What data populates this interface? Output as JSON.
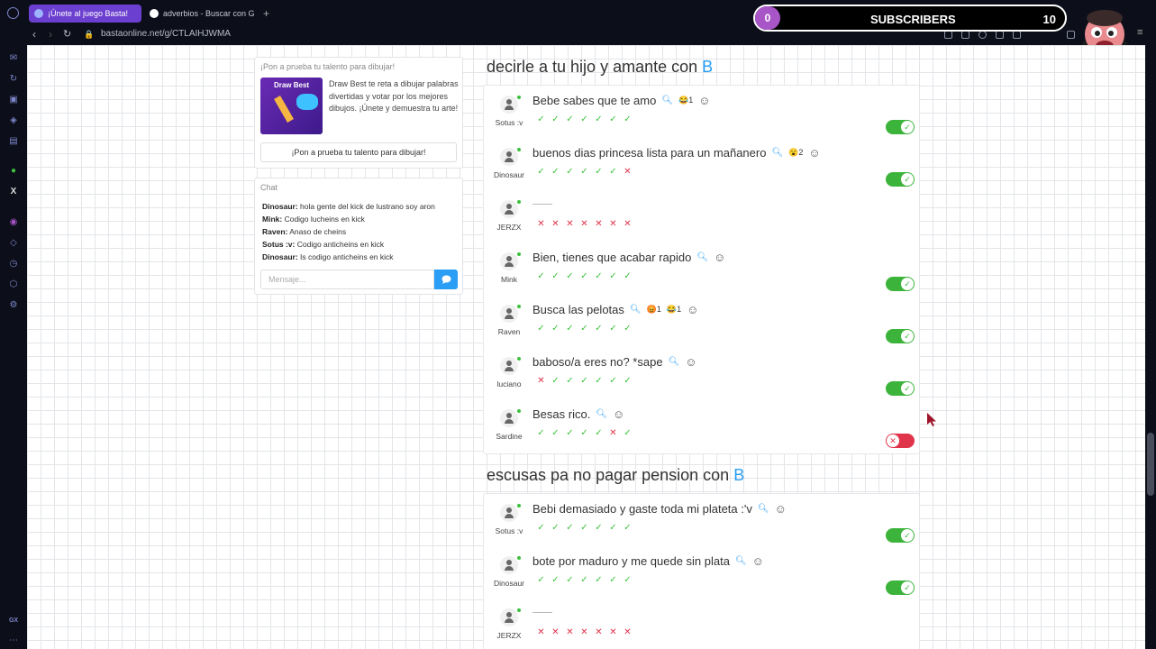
{
  "browser": {
    "tabs": [
      {
        "label": "¡Únete al juego Basta!",
        "active": true
      },
      {
        "label": "adverbios - Buscar con Go",
        "active": false
      }
    ],
    "url": "bastaonline.net/g/CTLAIHJWMA",
    "sidebar_bottom_label": "GX"
  },
  "overlay": {
    "subscriber_count": "0",
    "subscriber_label": "SUBSCRIBERS",
    "subscriber_goal": "10"
  },
  "draw_panel": {
    "title": "¡Pon a prueba tu talento para dibujar!",
    "image_title": "Draw Best",
    "description": "Draw Best te reta a dibujar palabras divertidas y votar por los mejores dibujos. ¡Únete y demuestra tu arte!",
    "button_label": "¡Pon a prueba tu talento para dibujar!"
  },
  "chat": {
    "title": "Chat",
    "messages": [
      {
        "user": "Dinosaur:",
        "text": "hola gente del kick de lustrano soy aron"
      },
      {
        "user": "Mink:",
        "text": "Codigo lucheins en kick"
      },
      {
        "user": "Raven:",
        "text": "Anaso de cheins"
      },
      {
        "user": "Sotus :v:",
        "text": "Codigo anticheins en kick"
      },
      {
        "user": "Dinosaur:",
        "text": "Is codigo anticheins en kick"
      }
    ],
    "input_placeholder": "Mensaje..."
  },
  "categories": [
    {
      "title": "decirle a tu hijo y amante con",
      "letter": "B",
      "rows": [
        {
          "user": "Sotus :v",
          "answer": "Bebe sabes que te amo",
          "reactions": [
            {
              "emoji": "😂",
              "count": "1"
            }
          ],
          "votes": [
            1,
            1,
            1,
            1,
            1,
            1,
            1
          ],
          "accepted": true
        },
        {
          "user": "Dinosaur",
          "answer": "buenos dias princesa lista para un mañanero",
          "reactions": [
            {
              "emoji": "😮",
              "count": "2"
            }
          ],
          "votes": [
            1,
            1,
            1,
            1,
            1,
            1,
            0
          ],
          "accepted": true
        },
        {
          "user": "JERZX",
          "answer": "",
          "reactions": [],
          "votes": [
            0,
            0,
            0,
            0,
            0,
            0,
            0
          ],
          "accepted": null
        },
        {
          "user": "Mink",
          "answer": "Bien, tienes que acabar rapido",
          "reactions": [],
          "votes": [
            1,
            1,
            1,
            1,
            1,
            1,
            1
          ],
          "accepted": true
        },
        {
          "user": "Raven",
          "answer": "Busca las pelotas",
          "reactions": [
            {
              "emoji": "😡",
              "count": "1"
            },
            {
              "emoji": "😂",
              "count": "1"
            }
          ],
          "votes": [
            1,
            1,
            1,
            1,
            1,
            1,
            1
          ],
          "accepted": true
        },
        {
          "user": "luciano",
          "answer": "baboso/a eres no? *sape",
          "reactions": [],
          "votes": [
            0,
            1,
            1,
            1,
            1,
            1,
            1
          ],
          "accepted": true
        },
        {
          "user": "Sardine",
          "answer": "Besas rico.",
          "reactions": [],
          "votes": [
            1,
            1,
            1,
            1,
            1,
            0,
            1
          ],
          "accepted": false
        }
      ]
    },
    {
      "title": "escusas pa no pagar pension con",
      "letter": "B",
      "rows": [
        {
          "user": "Sotus :v",
          "answer": "Bebi demasiado y gaste toda mi plateta :'v",
          "reactions": [],
          "votes": [
            1,
            1,
            1,
            1,
            1,
            1,
            1
          ],
          "accepted": true
        },
        {
          "user": "Dinosaur",
          "answer": "bote por maduro y me quede sin plata",
          "reactions": [],
          "votes": [
            1,
            1,
            1,
            1,
            1,
            1,
            1
          ],
          "accepted": true
        },
        {
          "user": "JERZX",
          "answer": "",
          "reactions": [],
          "votes": [
            0,
            0,
            0,
            0,
            0,
            0,
            0
          ],
          "accepted": null
        }
      ]
    }
  ],
  "colors": {
    "accent": "#2a9df4",
    "ok": "#3cb43b",
    "no": "#e0344a",
    "subscriber_accent": "#a855c7"
  }
}
